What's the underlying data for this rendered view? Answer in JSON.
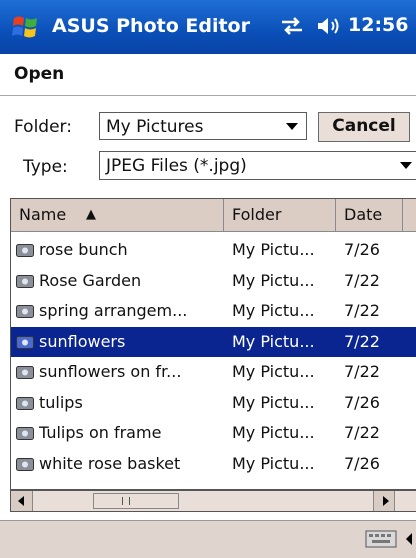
{
  "titlebar": {
    "app_title": "ASUS Photo Editor",
    "time": "12:56",
    "start_icon": "windows-flag-icon",
    "connectivity_icon": "connectivity-icon",
    "volume_icon": "volume-icon",
    "color": "#0a4fb8"
  },
  "dialog": {
    "title": "Open",
    "folder_label": "Folder:",
    "folder_value": "My Pictures",
    "cancel_label": "Cancel",
    "type_label": "Type:",
    "type_value": "JPEG Files (*.jpg)"
  },
  "list": {
    "columns": [
      "Name",
      "Folder",
      "Date"
    ],
    "sort_indicator": "▲",
    "selection_color": "#0a2490",
    "rows": [
      {
        "name": "rose bunch",
        "folder": "My Pictu...",
        "date": "7/26"
      },
      {
        "name": "Rose Garden",
        "folder": "My Pictu...",
        "date": "7/22"
      },
      {
        "name": "spring arrangem...",
        "folder": "My Pictu...",
        "date": "7/22"
      },
      {
        "name": "sunflowers",
        "folder": "My Pictu...",
        "date": "7/22",
        "selected": true
      },
      {
        "name": "sunflowers on fr...",
        "folder": "My Pictu...",
        "date": "7/22"
      },
      {
        "name": "tulips",
        "folder": "My Pictu...",
        "date": "7/26"
      },
      {
        "name": "Tulips on frame",
        "folder": "My Pictu...",
        "date": "7/22"
      },
      {
        "name": "white rose basket",
        "folder": "My Pictu...",
        "date": "7/26"
      }
    ]
  },
  "bottombar": {
    "keyboard_icon": "keyboard-icon"
  }
}
